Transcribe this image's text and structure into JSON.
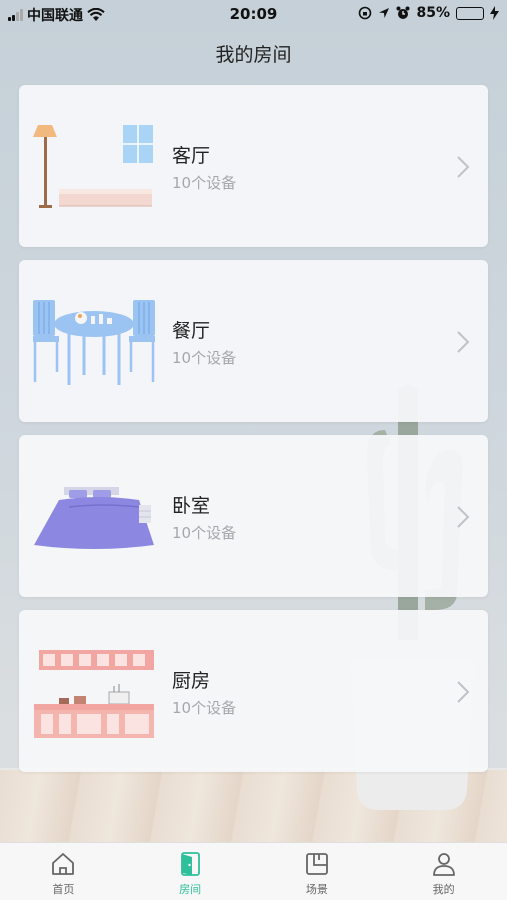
{
  "status_bar": {
    "carrier": "中国联通",
    "time": "20:09",
    "battery": "85%",
    "battery_level": 0.85
  },
  "page": {
    "title": "我的房间"
  },
  "rooms": [
    {
      "name": "客厅",
      "count": "10个设备",
      "icon": "living-room-illustration"
    },
    {
      "name": "餐厅",
      "count": "10个设备",
      "icon": "dining-room-illustration"
    },
    {
      "name": "卧室",
      "count": "10个设备",
      "icon": "bedroom-illustration"
    },
    {
      "name": "厨房",
      "count": "10个设备",
      "icon": "kitchen-illustration"
    }
  ],
  "tabs": [
    {
      "label": "首页",
      "icon": "home-icon",
      "active": false
    },
    {
      "label": "房间",
      "icon": "door-icon",
      "active": true
    },
    {
      "label": "场景",
      "icon": "scene-icon",
      "active": false
    },
    {
      "label": "我的",
      "icon": "user-icon",
      "active": false
    }
  ],
  "colors": {
    "accent": "#2ebf9b",
    "inactive": "#666666"
  }
}
